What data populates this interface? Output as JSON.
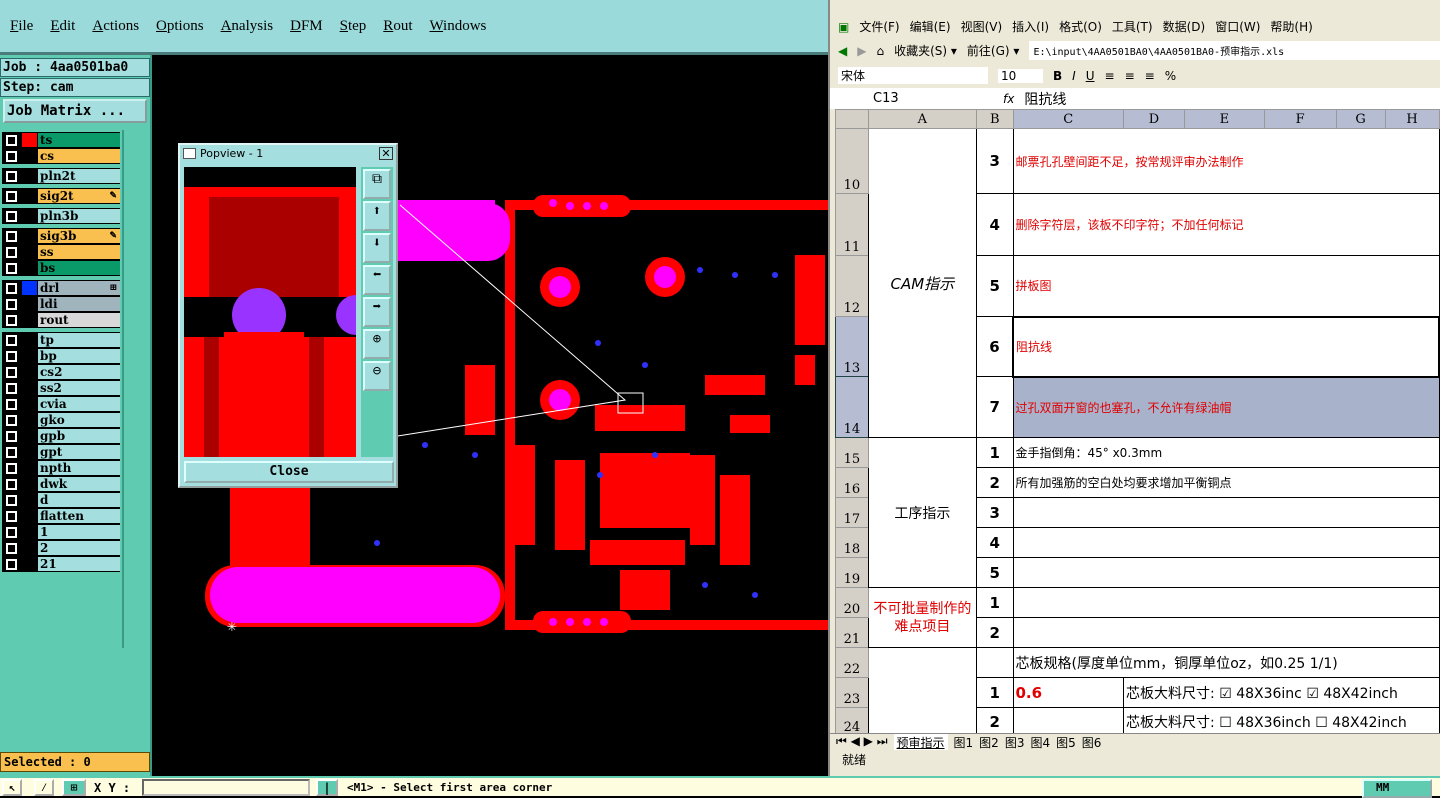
{
  "menu": [
    "File",
    "Edit",
    "Actions",
    "Options",
    "Analysis",
    "DFM",
    "Step",
    "Rout",
    "Windows"
  ],
  "job": {
    "job": "Job : 4aa0501ba0",
    "step": "Step: cam",
    "matrix_button": "Job Matrix ..."
  },
  "layers": [
    {
      "name": "ts",
      "color": "#0a9a6a",
      "swatch": "#ff0000"
    },
    {
      "name": "cs",
      "color": "#f9c04f",
      "swatch": "#000"
    },
    {
      "name": "pln2t",
      "color": "#a4dede",
      "swatch": "#000"
    },
    {
      "name": "sig2t",
      "color": "#f9c04f",
      "swatch": "#000",
      "mark": "✎"
    },
    {
      "name": "pln3b",
      "color": "#a4dede",
      "swatch": "#000"
    },
    {
      "name": "sig3b",
      "color": "#f9c04f",
      "swatch": "#000",
      "mark": "✎"
    },
    {
      "name": "ss",
      "color": "#f9c04f",
      "swatch": "#000"
    },
    {
      "name": "bs",
      "color": "#0a9a6a",
      "swatch": "#000"
    },
    {
      "name": "drl",
      "color": "#9fb4bc",
      "swatch": "#0033ff",
      "mark": "⊞"
    },
    {
      "name": "ldi",
      "color": "#9fb4bc",
      "swatch": "#000"
    },
    {
      "name": "rout",
      "color": "#d8d8d8",
      "swatch": "#000"
    },
    {
      "name": "tp",
      "color": "#a4dede",
      "swatch": "#000"
    },
    {
      "name": "bp",
      "color": "#a4dede",
      "swatch": "#000"
    },
    {
      "name": "cs2",
      "color": "#a4dede",
      "swatch": "#000"
    },
    {
      "name": "ss2",
      "color": "#a4dede",
      "swatch": "#000"
    },
    {
      "name": "cvia",
      "color": "#a4dede",
      "swatch": "#000"
    },
    {
      "name": "gko",
      "color": "#a4dede",
      "swatch": "#000"
    },
    {
      "name": "gpb",
      "color": "#a4dede",
      "swatch": "#000"
    },
    {
      "name": "gpt",
      "color": "#a4dede",
      "swatch": "#000"
    },
    {
      "name": "npth",
      "color": "#a4dede",
      "swatch": "#000"
    },
    {
      "name": "dwk",
      "color": "#a4dede",
      "swatch": "#000"
    },
    {
      "name": "d",
      "color": "#a4dede",
      "swatch": "#000"
    },
    {
      "name": "flatten",
      "color": "#a4dede",
      "swatch": "#000"
    },
    {
      "name": "1",
      "color": "#a4dede",
      "swatch": "#000"
    },
    {
      "name": "2",
      "color": "#a4dede",
      "swatch": "#000"
    },
    {
      "name": "21",
      "color": "#a4dede",
      "swatch": "#000"
    }
  ],
  "selected": "Selected : 0",
  "status": {
    "xy_label": "X Y :",
    "xy_value": "",
    "prompt": "<M1> - Select first area corner",
    "units": "MM"
  },
  "popview": {
    "title": "Popview - 1",
    "close": "Close"
  },
  "excel": {
    "menu": [
      "文件(F)",
      "编辑(E)",
      "视图(V)",
      "插入(I)",
      "格式(O)",
      "工具(T)",
      "数据(D)",
      "窗口(W)",
      "帮助(H)"
    ],
    "favorites": "收藏夹(S) ▾",
    "goto": "前往(G) ▾",
    "path": "E:\\input\\4AA0501BA0\\4AA0501BA0-预审指示.xls",
    "font": "宋体",
    "size": "10",
    "cell_ref": "C13",
    "formula": "阻抗线",
    "columns": [
      "A",
      "B",
      "C",
      "D",
      "E",
      "F",
      "G",
      "H"
    ],
    "sections": {
      "cam": "CAM指示",
      "process": "工序指示",
      "hard": "不可批量制作的难点项目"
    },
    "cam_rows": [
      {
        "row": "10",
        "n": "3",
        "text": "邮票孔孔壁间距不足，按常规评审办法制作"
      },
      {
        "row": "11",
        "n": "4",
        "text": "删除字符层，该板不印字符；不加任何标记"
      },
      {
        "row": "12",
        "n": "5",
        "text": "拼板图"
      },
      {
        "row": "13",
        "n": "6",
        "text": "阻抗线"
      },
      {
        "row": "14",
        "n": "7",
        "text": "过孔双面开窗的也塞孔，不允许有绿油帽"
      }
    ],
    "process_rows": [
      {
        "row": "15",
        "n": "1",
        "text": "金手指倒角：45° x0.3mm"
      },
      {
        "row": "16",
        "n": "2",
        "text": "所有加强筋的空白处均要求增加平衡铜点"
      },
      {
        "row": "17",
        "n": "3",
        "text": ""
      },
      {
        "row": "18",
        "n": "4",
        "text": ""
      },
      {
        "row": "19",
        "n": "5",
        "text": ""
      }
    ],
    "hard_rows": [
      {
        "row": "20",
        "n": "1"
      },
      {
        "row": "21",
        "n": "2"
      }
    ],
    "row22": {
      "row": "22",
      "text": "芯板规格(厚度单位mm，铜厚单位oz，如0.25 1/1)"
    },
    "row23": {
      "row": "23",
      "n": "1",
      "value": "0.6",
      "label": "芯板大料尺寸:",
      "opt1": "☑ 48X36inc",
      "opt2": "☑ 48X42inch"
    },
    "row24": {
      "row": "24",
      "n": "2",
      "label": "芯板大料尺寸:",
      "opt1": "☐ 48X36inch",
      "opt2": "☐ 48X42inch"
    },
    "sheet_tabs": [
      "预审指示",
      "图1",
      "图2",
      "图3",
      "图4",
      "图5",
      "图6"
    ],
    "status": "就绪"
  }
}
